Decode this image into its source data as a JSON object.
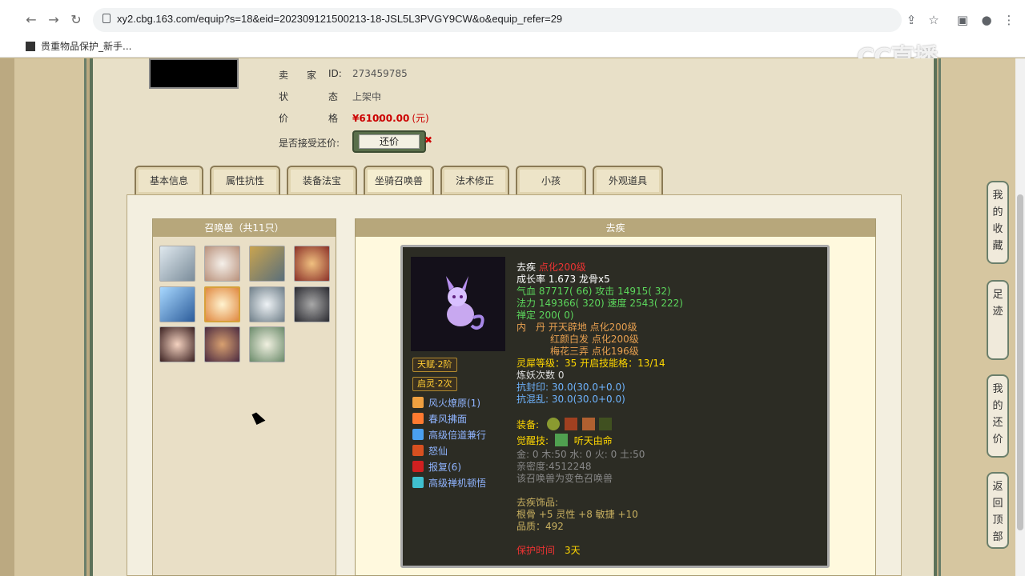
{
  "browser": {
    "url": "xy2.cbg.163.com/equip?s=18&eid=202309121500213-18-JSL5L3PVGY9CW&o&equip_refer=29",
    "bookmark": "贵重物品保护_新手...",
    "watermark": "CC直播"
  },
  "seller": {
    "seller_label": "卖家",
    "id_label": "ID:",
    "id_value": "273459785",
    "status_label": "状态:",
    "status_value": "上架中",
    "price_label": "价格:",
    "price_value": "¥61000.00",
    "price_unit": "(元)",
    "counter_label": "是否接受还价:",
    "counter_button": "还价"
  },
  "tabs": [
    "基本信息",
    "属性抗性",
    "装备法宝",
    "坐骑召唤兽",
    "法术修正",
    "小孩",
    "外观道具"
  ],
  "pets_panel": {
    "title": "召唤兽（共11只）"
  },
  "detail_panel": {
    "title": "去疾"
  },
  "pet": {
    "tags": [
      "天赋·2阶",
      "启灵·2次"
    ],
    "skills": [
      {
        "name": "风火燎原(1)",
        "color": "#f0a040"
      },
      {
        "name": "春风拂面",
        "color": "#ff7a30"
      },
      {
        "name": "高级倍道兼行",
        "color": "#4a9ff0"
      },
      {
        "name": "怒仙",
        "color": "#d85020"
      },
      {
        "name": "报复(6)",
        "color": "#d02020"
      },
      {
        "name": "高级禅机顿悟",
        "color": "#40c0d0"
      }
    ],
    "name": "去疾",
    "level": "点化200级",
    "growth": "成长率 1.673 龙骨x5",
    "hp": "气血 87717( 66)",
    "atk": "攻击 14915( 32)",
    "mp": "法力 149366( 320)",
    "spd": "速度 2543( 222)",
    "calm": "禅定 200( 0)",
    "core_label": "内　丹",
    "core1": "开天辟地 点化200级",
    "core2": "红颜白发 点化200级",
    "core3": "梅花三弄 点化196级",
    "rhino": "灵犀等级：35 开启技能格：13/14",
    "refine": "炼妖次数 0",
    "res1": "抗封印: 30.0(30.0+0.0)",
    "res2": "抗混乱: 30.0(30.0+0.0)",
    "equip_label": "装备:",
    "awaken_label": "觉醒技:",
    "awaken_skill": "听天由命",
    "elements": "金: 0 木:50 水: 0 火: 0 土:50",
    "intimacy": "亲密度:4512248",
    "variant": "该召唤兽为变色召唤兽",
    "ornament_title": "去疾饰品:",
    "ornament_attr": "根骨 +5 灵性 +8 敏捷 +10",
    "ornament_quality": "品质：492",
    "protect_label": "保护时间",
    "protect_value": "3天"
  },
  "side_buttons": [
    "我的收藏",
    "足迹",
    "我的还价",
    "返回顶部"
  ]
}
